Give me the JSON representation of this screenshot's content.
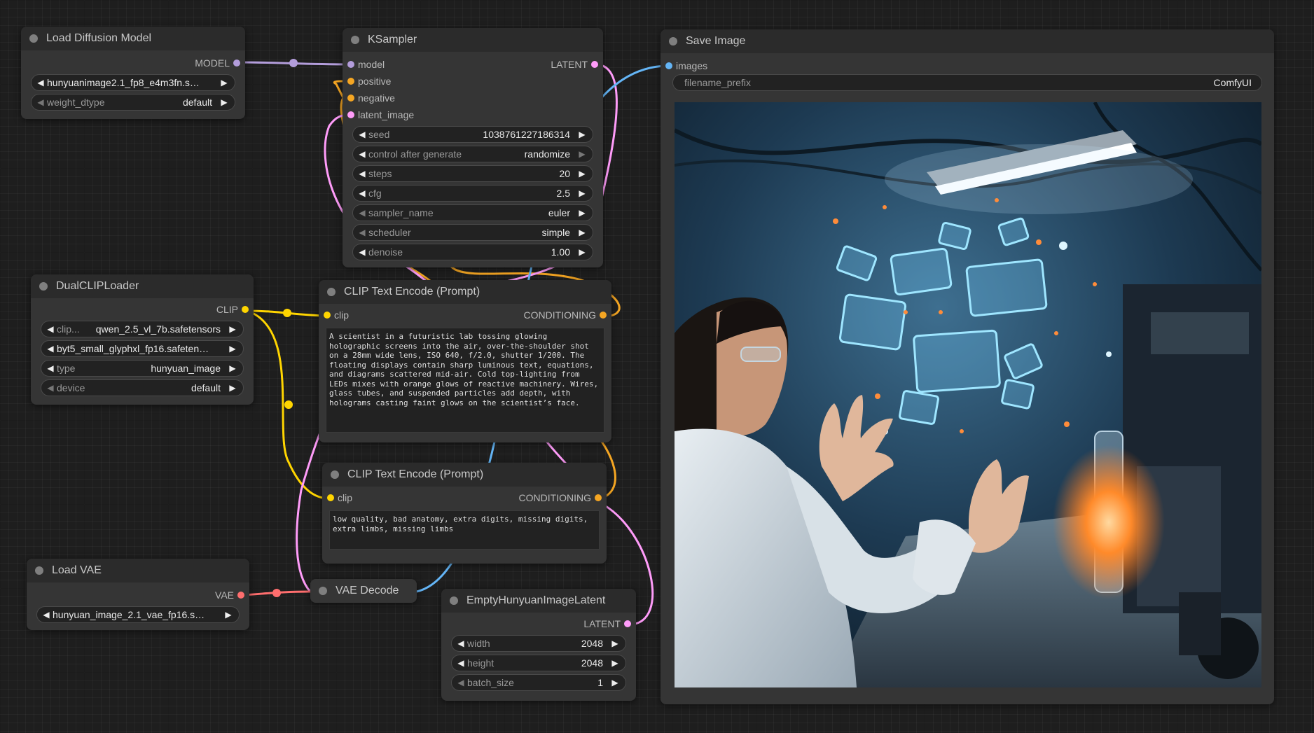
{
  "colors": {
    "model": "#b39ddb",
    "conditioning": "#f5a623",
    "latent": "#ff9cf9",
    "clip": "#ffd500",
    "vae": "#ff6e6e",
    "image": "#64b5f6"
  },
  "nodes": {
    "load_diffusion_model": {
      "title": "Load Diffusion Model",
      "output": "MODEL",
      "unet_name": "hunyuanimage2.1_fp8_e4m3fn.s…",
      "weight_dtype_label": "weight_dtype",
      "weight_dtype_value": "default"
    },
    "ksampler": {
      "title": "KSampler",
      "inputs": [
        "model",
        "positive",
        "negative",
        "latent_image"
      ],
      "output": "LATENT",
      "widgets": [
        {
          "name": "seed",
          "value": "1038761227186314"
        },
        {
          "name": "control after generate",
          "value": "randomize"
        },
        {
          "name": "steps",
          "value": "20"
        },
        {
          "name": "cfg",
          "value": "2.5"
        },
        {
          "name": "sampler_name",
          "value": "euler"
        },
        {
          "name": "scheduler",
          "value": "simple"
        },
        {
          "name": "denoise",
          "value": "1.00"
        }
      ]
    },
    "save_image": {
      "title": "Save Image",
      "input": "images",
      "prefix_label": "filename_prefix",
      "prefix_value": "ComfyUI"
    },
    "dual_clip_loader": {
      "title": "DualCLIPLoader",
      "output": "CLIP",
      "clip1_label": "clip...",
      "clip1_value": "qwen_2.5_vl_7b.safetensors",
      "clip2_value": "byt5_small_glyphxl_fp16.safeten…",
      "type_label": "type",
      "type_value": "hunyuan_image",
      "device_label": "device",
      "device_value": "default"
    },
    "clip_text_encode_positive": {
      "title": "CLIP Text Encode (Prompt)",
      "input": "clip",
      "output": "CONDITIONING",
      "text": "A scientist in a futuristic lab tossing glowing holographic screens into the air, over-the-shoulder shot on a 28mm wide lens, ISO 640, f/2.0, shutter 1/200. The floating displays contain sharp luminous text, equations, and diagrams scattered mid-air. Cold top-lighting from LEDs mixes with orange glows of reactive machinery. Wires, glass tubes, and suspended particles add depth, with holograms casting faint glows on the scientist’s face."
    },
    "clip_text_encode_negative": {
      "title": "CLIP Text Encode (Prompt)",
      "input": "clip",
      "output": "CONDITIONING",
      "text": "low quality, bad anatomy, extra digits, missing digits, extra limbs, missing limbs"
    },
    "load_vae": {
      "title": "Load VAE",
      "output": "VAE",
      "vae_name": "hunyuan_image_2.1_vae_fp16.s…"
    },
    "vae_decode": {
      "title": "VAE Decode"
    },
    "empty_latent": {
      "title": "EmptyHunyuanImageLatent",
      "output": "LATENT",
      "widgets": [
        {
          "name": "width",
          "value": "2048"
        },
        {
          "name": "height",
          "value": "2048"
        },
        {
          "name": "batch_size",
          "value": "1"
        }
      ]
    }
  }
}
